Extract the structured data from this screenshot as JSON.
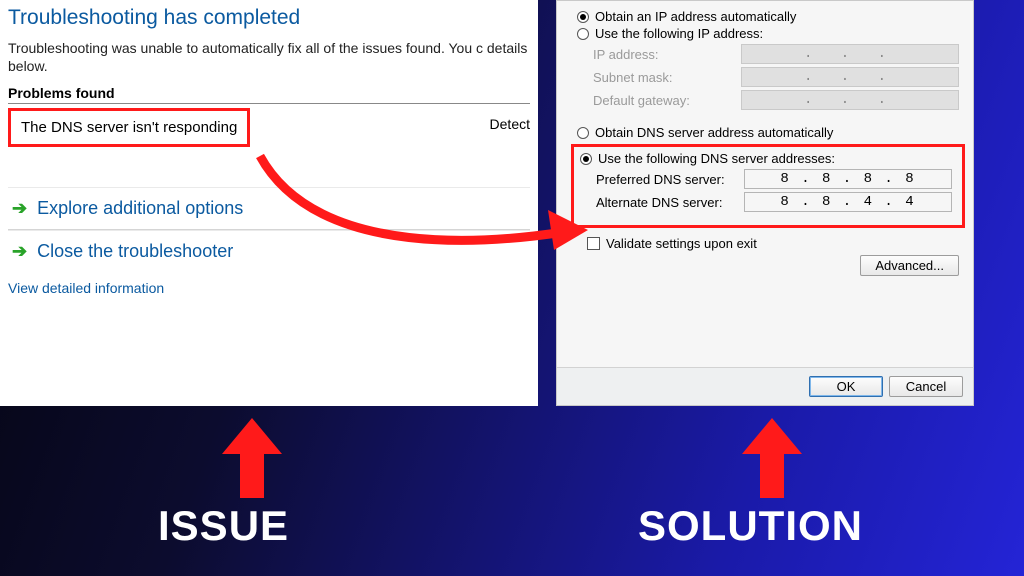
{
  "troubleshooter": {
    "title": "Troubleshooting has completed",
    "description": "Troubleshooting was unable to automatically fix all of the issues found. You c details below.",
    "problems_header": "Problems found",
    "problem_text": "The DNS server isn't responding",
    "detected_label": "Detect",
    "options": [
      {
        "label": "Explore additional options"
      },
      {
        "label": "Close the troubleshooter"
      }
    ],
    "detail_link": "View detailed information"
  },
  "ipv4": {
    "ip_auto": "Obtain an IP address automatically",
    "ip_manual": "Use the following IP address:",
    "ip_address_label": "IP address:",
    "subnet_label": "Subnet mask:",
    "gateway_label": "Default gateway:",
    "ip_dots": ".     .     .",
    "dns_auto": "Obtain DNS server address automatically",
    "dns_manual": "Use the following DNS server addresses:",
    "pref_dns_label": "Preferred DNS server:",
    "alt_dns_label": "Alternate DNS server:",
    "pref_dns_value": "8 . 8 . 8 . 8",
    "alt_dns_value": "8 . 8 . 4 . 4",
    "validate_label": "Validate settings upon exit",
    "advanced_btn": "Advanced...",
    "ok_btn": "OK",
    "cancel_btn": "Cancel"
  },
  "annotations": {
    "issue": "ISSUE",
    "solution": "SOLUTION"
  }
}
